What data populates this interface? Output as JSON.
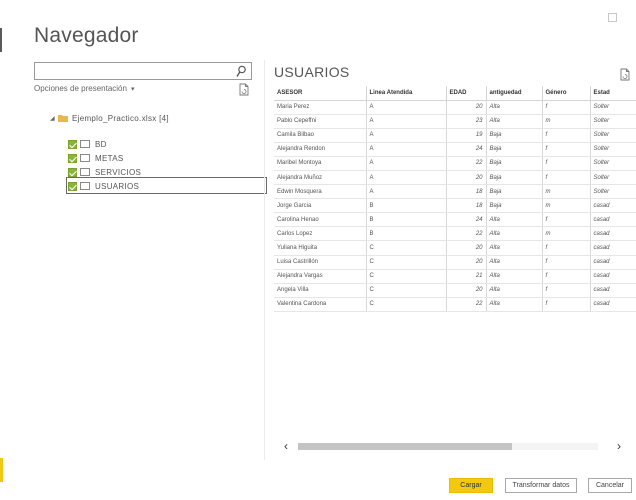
{
  "window": {
    "title": "Navegador"
  },
  "left_pane": {
    "search": {
      "value": "",
      "placeholder": ""
    },
    "options_label": "Opciones de presentación",
    "tree": {
      "root_label": "Ejemplo_Practico.xlsx [4]",
      "items": [
        {
          "label": "BD",
          "checked": true
        },
        {
          "label": "METAS",
          "checked": true
        },
        {
          "label": "SERVICIOS",
          "checked": true
        },
        {
          "label": "USUARIOS",
          "checked": true,
          "selected": true
        }
      ]
    }
  },
  "preview": {
    "title": "USUARIOS",
    "columns": [
      "ASESOR",
      "Linea Atendida",
      "EDAD",
      "antiguedad",
      "Género",
      "Estad"
    ],
    "rows": [
      [
        "Maria Perez",
        "A",
        "20",
        "Alta",
        "f",
        "Solter"
      ],
      [
        "Pablo Cepeffni",
        "A",
        "23",
        "Alta",
        "m",
        "Solter"
      ],
      [
        "Camila Bilbao",
        "A",
        "19",
        "Baja",
        "f",
        "Solter"
      ],
      [
        "Alejandra Rendon",
        "A",
        "24",
        "Baja",
        "f",
        "Solter"
      ],
      [
        "Maribel Montoya",
        "A",
        "22",
        "Baja",
        "f",
        "Solter"
      ],
      [
        "Alejandra Muñoz",
        "A",
        "20",
        "Baja",
        "f",
        "Solter"
      ],
      [
        "Edwin Mosquera",
        "A",
        "18",
        "Baja",
        "m",
        "Solter"
      ],
      [
        "Jorge Garcia",
        "B",
        "18",
        "Baja",
        "m",
        "casad"
      ],
      [
        "Carolina Henao",
        "B",
        "24",
        "Alta",
        "f",
        "casad"
      ],
      [
        "Carlos Lopez",
        "B",
        "22",
        "Alta",
        "m",
        "casad"
      ],
      [
        "Yuliana Higuita",
        "C",
        "20",
        "Alta",
        "f",
        "casad"
      ],
      [
        "Luisa Castrillón",
        "C",
        "20",
        "Alta",
        "f",
        "casad"
      ],
      [
        "Alejandra Vargas",
        "C",
        "21",
        "Alta",
        "f",
        "casad"
      ],
      [
        "Angela Villa",
        "C",
        "20",
        "Alta",
        "f",
        "casad"
      ],
      [
        "Valentina Cardona",
        "C",
        "22",
        "Alta",
        "f",
        "casad"
      ]
    ]
  },
  "footer": {
    "load_label": "Cargar",
    "transform_label": "Transformar datos",
    "cancel_label": "Cancelar"
  },
  "colors": {
    "accent": "#f2c811",
    "checkbox": "#8ab53a"
  },
  "icons": {
    "search": "search-icon",
    "options_caret": "chevron-down-icon",
    "refresh_doc": "document-icon",
    "folder": "folder-icon",
    "table": "table-icon",
    "maximize": "maximize-icon"
  }
}
